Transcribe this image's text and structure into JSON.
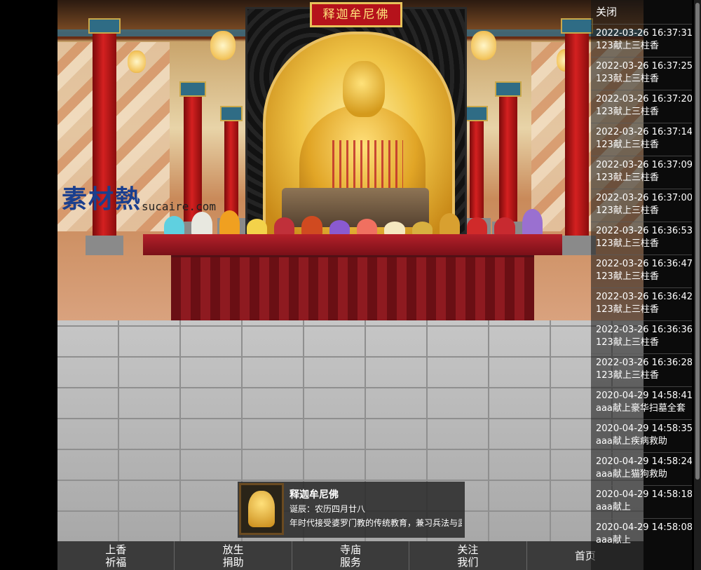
{
  "temple": {
    "sign": "释迦牟尼佛",
    "watermark": "素材熱",
    "watermark_sub": "sucaire.com"
  },
  "info_card": {
    "name": "释迦牟尼佛",
    "birth": "诞辰：农历四月廿八",
    "description": "年时代接受婆罗门教的传统教育，兼习兵法与武"
  },
  "sidebar": {
    "close_label": "关闭",
    "logs": [
      {
        "time": "2022-03-26 16:37:31",
        "text": "123献上三柱香"
      },
      {
        "time": "2022-03-26 16:37:25",
        "text": "123献上三柱香"
      },
      {
        "time": "2022-03-26 16:37:20",
        "text": "123献上三柱香"
      },
      {
        "time": "2022-03-26 16:37:14",
        "text": "123献上三柱香"
      },
      {
        "time": "2022-03-26 16:37:09",
        "text": "123献上三柱香"
      },
      {
        "time": "2022-03-26 16:37:00",
        "text": "123献上三柱香"
      },
      {
        "time": "2022-03-26 16:36:53",
        "text": "123献上三柱香"
      },
      {
        "time": "2022-03-26 16:36:47",
        "text": "123献上三柱香"
      },
      {
        "time": "2022-03-26 16:36:42",
        "text": "123献上三柱香"
      },
      {
        "time": "2022-03-26 16:36:36",
        "text": "123献上三柱香"
      },
      {
        "time": "2022-03-26 16:36:28",
        "text": "123献上三柱香"
      },
      {
        "time": "2020-04-29 14:58:41",
        "text": "aaa献上豪华扫墓全套"
      },
      {
        "time": "2020-04-29 14:58:35",
        "text": "aaa献上疾病救助"
      },
      {
        "time": "2020-04-29 14:58:24",
        "text": "aaa献上猫狗救助"
      },
      {
        "time": "2020-04-29 14:58:18",
        "text": "aaa献上"
      },
      {
        "time": "2020-04-29 14:58:08",
        "text": "aaa献上"
      }
    ]
  },
  "nav": [
    {
      "line1": "上香",
      "line2": "祈福"
    },
    {
      "line1": "放生",
      "line2": "捐助"
    },
    {
      "line1": "寺庙",
      "line2": "服务"
    },
    {
      "line1": "关注",
      "line2": "我们"
    },
    {
      "line1": "首页",
      "line2": ""
    }
  ],
  "colors": {
    "nav_bg": "#3b3b3b",
    "sign_bg": "#b5121b",
    "sign_text": "#ffe27a"
  }
}
